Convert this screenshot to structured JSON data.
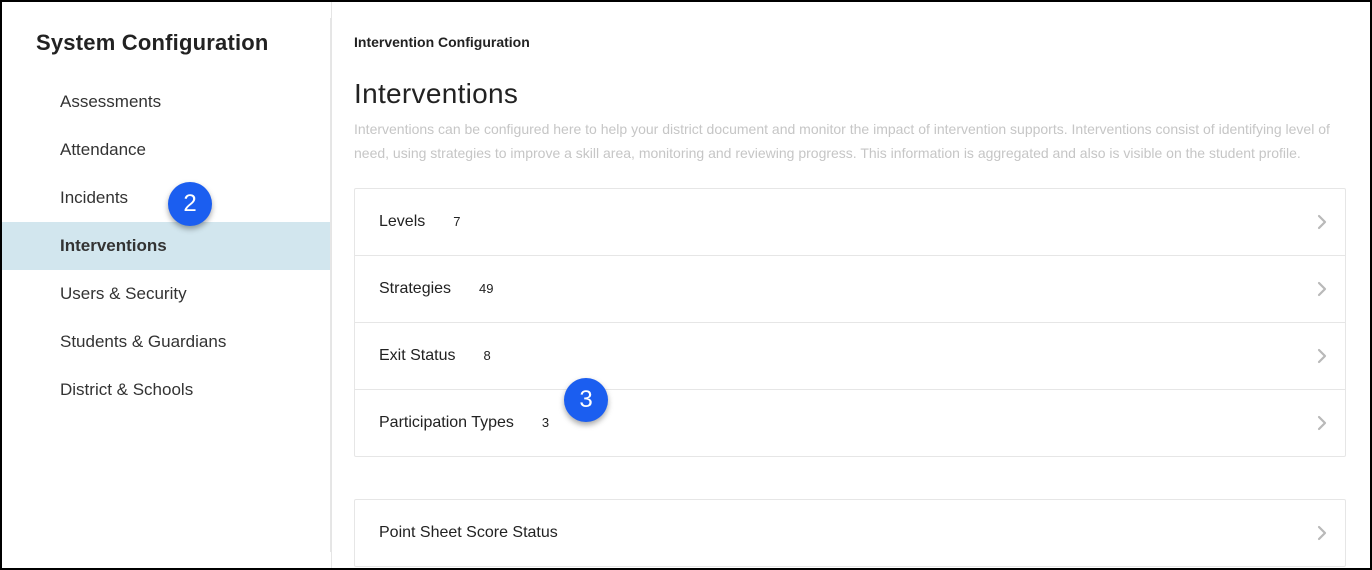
{
  "sidebar": {
    "title": "System Configuration",
    "items": [
      {
        "label": "Assessments"
      },
      {
        "label": "Attendance"
      },
      {
        "label": "Incidents"
      },
      {
        "label": "Interventions",
        "active": true
      },
      {
        "label": "Users & Security"
      },
      {
        "label": "Students & Guardians"
      },
      {
        "label": "District & Schools"
      }
    ]
  },
  "main": {
    "breadcrumb": "Intervention Configuration",
    "heading": "Interventions",
    "description": "Interventions can be configured here to help your district document and monitor the impact of intervention supports. Interventions consist of identifying level of need, using strategies to improve a skill area, monitoring and reviewing progress. This information is aggregated and also is visible on the student profile.",
    "rows": [
      {
        "label": "Levels",
        "count": "7"
      },
      {
        "label": "Strategies",
        "count": "49"
      },
      {
        "label": "Exit Status",
        "count": "8"
      },
      {
        "label": "Participation Types",
        "count": "3"
      },
      {
        "label": "Point Sheet Score Status",
        "count": ""
      }
    ]
  },
  "annotations": {
    "badge2": "2",
    "badge3": "3"
  },
  "colors": {
    "badge": "#1b5ef0",
    "active_sidebar": "#d2e6ee",
    "chevron": "#b9b9b9"
  }
}
